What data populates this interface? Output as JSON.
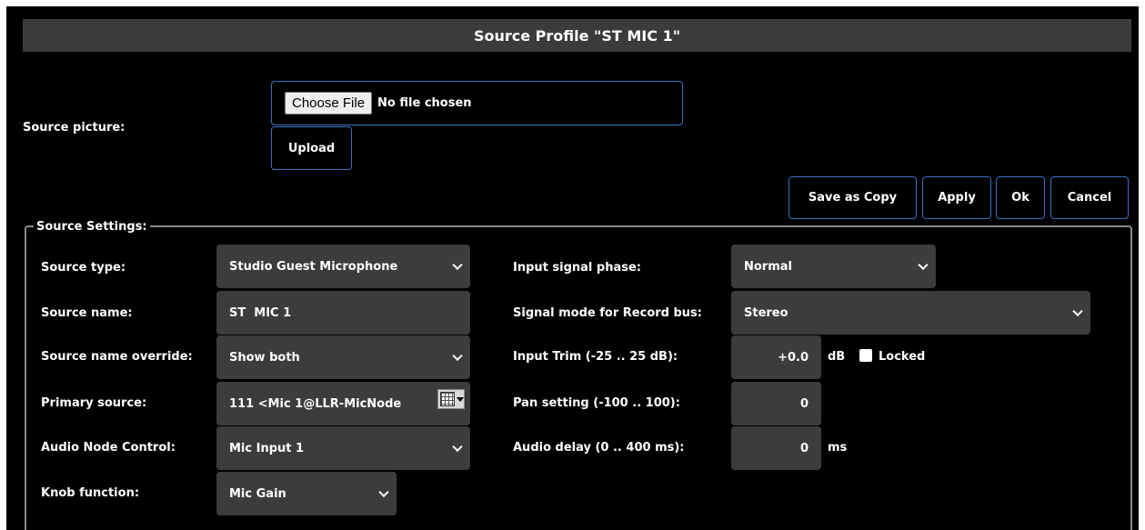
{
  "title": "Source Profile \"ST MIC 1\"",
  "picture": {
    "label": "Source picture:",
    "choose_label": "Choose File",
    "file_status": "No file chosen",
    "upload_label": "Upload"
  },
  "actions": {
    "save_copy": "Save as Copy",
    "apply": "Apply",
    "ok": "Ok",
    "cancel": "Cancel"
  },
  "settings": {
    "legend": "Source Settings:",
    "left": {
      "source_type": {
        "label": "Source type:",
        "value": "Studio Guest Microphone"
      },
      "source_name": {
        "label": "Source name:",
        "value": "ST  MIC 1"
      },
      "name_override": {
        "label": "Source name override:",
        "value": "Show both"
      },
      "primary_source": {
        "label": "Primary source:",
        "value": "111 <Mic 1@LLR-MicNode"
      },
      "node_control": {
        "label": "Audio Node Control:",
        "value": "Mic Input 1"
      },
      "knob_function": {
        "label": "Knob function:",
        "value": "Mic Gain"
      }
    },
    "right": {
      "phase": {
        "label": "Input signal phase:",
        "value": "Normal"
      },
      "record_mode": {
        "label": "Signal mode for Record bus:",
        "value": "Stereo"
      },
      "trim": {
        "label": "Input Trim (-25 .. 25 dB):",
        "value": "+0.0",
        "unit": "dB",
        "locked_label": "Locked"
      },
      "pan": {
        "label": "Pan setting (-100 .. 100):",
        "value": "0"
      },
      "delay": {
        "label": "Audio delay (0 .. 400 ms):",
        "value": "0",
        "unit": "ms"
      }
    }
  },
  "colors": {
    "background": "#000000",
    "titlebar": "#3b3b3b",
    "control": "#3c3c3c",
    "button_border": "#3a6fc0"
  }
}
